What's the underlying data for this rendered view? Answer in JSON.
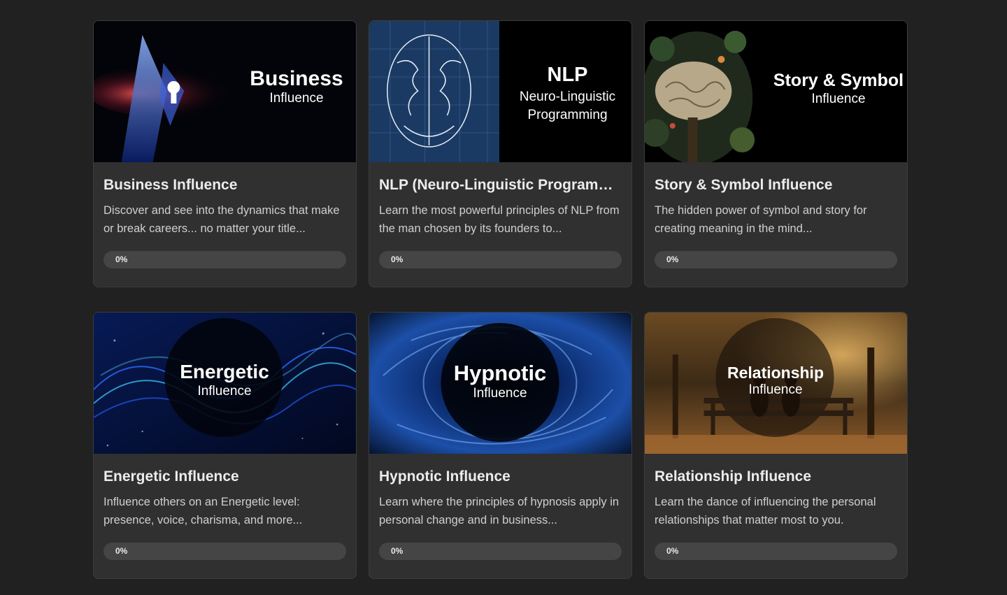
{
  "courses": [
    {
      "overlay_main": "Business",
      "overlay_sub": "Influence",
      "title": "Business Influence",
      "description": "Discover and see into the dynamics that make or break careers... no matter your title...",
      "progress_label": "0%",
      "progress": 0
    },
    {
      "overlay_main": "NLP",
      "overlay_sub": "Neuro-Linguistic Programming",
      "title": "NLP (Neuro-Linguistic Programmi...",
      "description": "Learn the most powerful principles of NLP from the man chosen by its founders to...",
      "progress_label": "0%",
      "progress": 0
    },
    {
      "overlay_main": "Story & Symbol",
      "overlay_sub": "Influence",
      "title": "Story & Symbol Influence",
      "description": "The hidden power of symbol and story for creating meaning in the mind...",
      "progress_label": "0%",
      "progress": 0
    },
    {
      "overlay_main": "Energetic",
      "overlay_sub": "Influence",
      "title": "Energetic Influence",
      "description": "Influence others on an Energetic level: presence, voice, charisma, and more...",
      "progress_label": "0%",
      "progress": 0
    },
    {
      "overlay_main": "Hypnotic",
      "overlay_sub": "Influence",
      "title": "Hypnotic Influence",
      "description": "Learn where the principles of hypnosis apply in personal change and in business...",
      "progress_label": "0%",
      "progress": 0
    },
    {
      "overlay_main": "Relationship",
      "overlay_sub": "Influence",
      "title": "Relationship Influence",
      "description": "Learn the dance of influencing the personal relationships that matter most to you.",
      "progress_label": "0%",
      "progress": 0
    }
  ],
  "colors": {
    "page_bg": "#212121",
    "card_bg": "#303030",
    "progress_track": "#454545"
  }
}
